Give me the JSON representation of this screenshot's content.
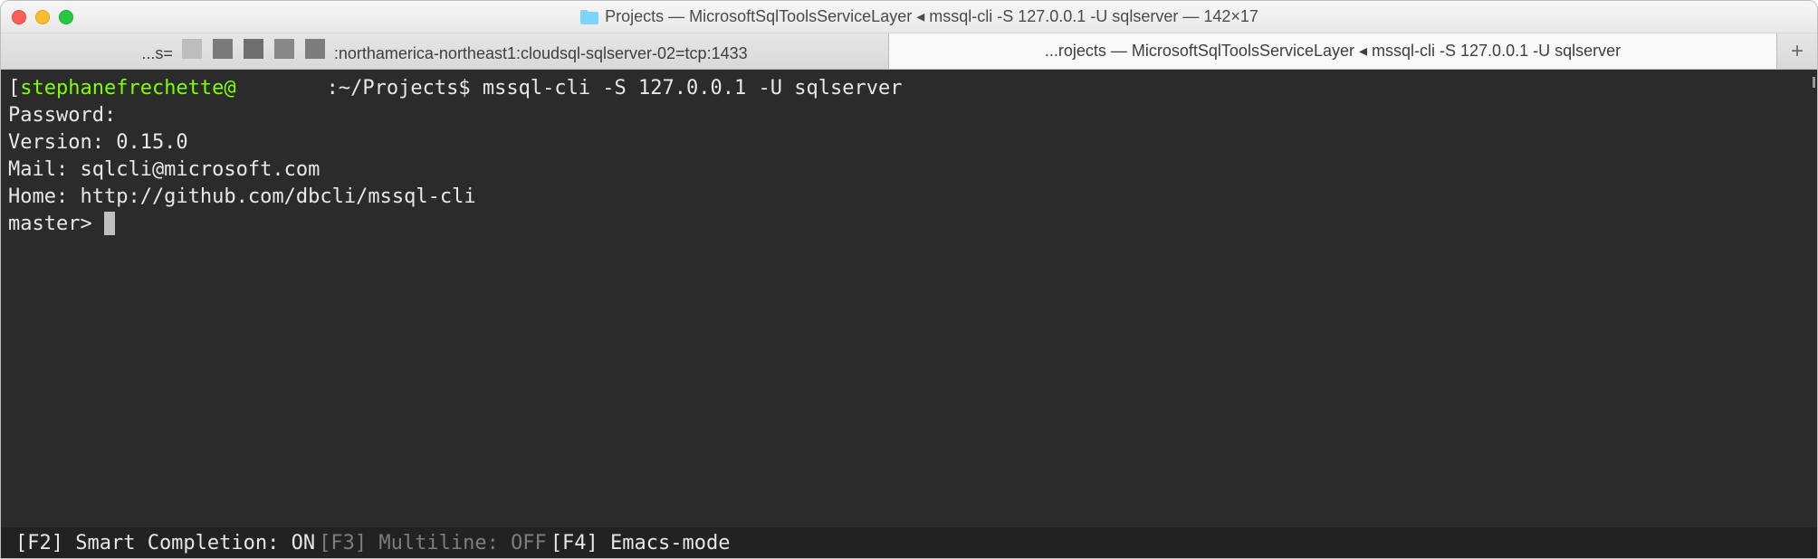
{
  "titlebar": {
    "title": "Projects — MicrosoftSqlToolsServiceLayer ◂ mssql-cli -S 127.0.0.1 -U sqlserver — 142×17"
  },
  "tabs": {
    "tab1_prefix": "...s=",
    "tab1_suffix": ":northamerica-northeast1:cloudsql-sqlserver-02=tcp:1433",
    "tab2": "...rojects — MicrosoftSqlToolsServiceLayer ◂ mssql-cli -S 127.0.0.1 -U sqlserver",
    "newtab": "+"
  },
  "terminal": {
    "bracket_open": "[",
    "user_host": "stephanefrechette@",
    "path_prompt": ":~/Projects$ ",
    "command": "mssql-cli -S 127.0.0.1 -U sqlserver",
    "line_password": "Password:",
    "line_version": "Version: 0.15.0",
    "line_mail": "Mail: sqlcli@microsoft.com",
    "line_home": "Home: http://github.com/dbcli/mssql-cli",
    "prompt2": "master> "
  },
  "statusbar": {
    "f2": " [F2] Smart Completion: ON  ",
    "f3": "[F3] Multiline: OFF  ",
    "f4": "[F4] Emacs-mode"
  }
}
